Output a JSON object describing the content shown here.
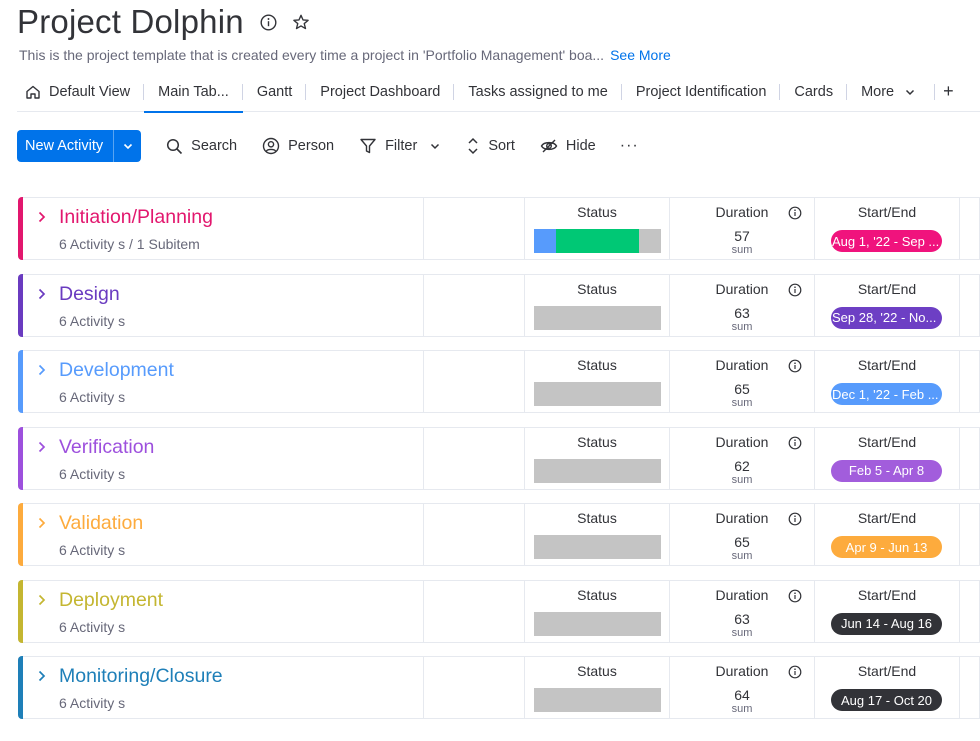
{
  "header": {
    "title": "Project Dolphin",
    "description": "This is the project template that is created every time a project in 'Portfolio Management' boa...",
    "see_more": "See More"
  },
  "tabs": [
    {
      "label": "Default View",
      "icon": "home-icon"
    },
    {
      "label": "Main Tab...",
      "active": true
    },
    {
      "label": "Gantt"
    },
    {
      "label": "Project Dashboard"
    },
    {
      "label": "Tasks assigned to me"
    },
    {
      "label": "Project Identification"
    },
    {
      "label": "Cards"
    },
    {
      "label": "More"
    }
  ],
  "tab_add": "+",
  "toolbar": {
    "new_label": "New Activity",
    "search": "Search",
    "person": "Person",
    "filter": "Filter",
    "sort": "Sort",
    "hide": "Hide",
    "more": "···"
  },
  "columns": {
    "status": "Status",
    "duration": "Duration",
    "start_end": "Start/End",
    "sum": "sum"
  },
  "colors": {
    "accent": "#0073ea",
    "status_gray": "#c4c4c4",
    "status_green": "#00c875",
    "status_blue": "#579bfc"
  },
  "groups": [
    {
      "name": "Initiation/Planning",
      "count": "6 Activity s / 1 Subitem",
      "color": "#e2176e",
      "duration": "57",
      "dates": "Aug 1, '22 - Sep ...",
      "pill_color": "#f0137d",
      "status": [
        {
          "color": "#579bfc",
          "share": 0.17
        },
        {
          "color": "#00c875",
          "share": 0.66
        }
      ]
    },
    {
      "name": "Design",
      "count": "6 Activity s",
      "color": "#6a3bc0",
      "duration": "63",
      "dates": "Sep 28, '22 - No...",
      "pill_color": "#6d3fc4",
      "status": []
    },
    {
      "name": "Development",
      "count": "6 Activity s",
      "color": "#579bfc",
      "duration": "65",
      "dates": "Dec 1, '22 - Feb ...",
      "pill_color": "#579bfc",
      "status": []
    },
    {
      "name": "Verification",
      "count": "6 Activity s",
      "color": "#9d50dd",
      "duration": "62",
      "dates": "Feb 5 - Apr 8",
      "pill_color": "#a25ddc",
      "status": []
    },
    {
      "name": "Validation",
      "count": "6 Activity s",
      "color": "#fdab3d",
      "duration": "65",
      "dates": "Apr 9 - Jun 13",
      "pill_color": "#fdab3d",
      "status": []
    },
    {
      "name": "Deployment",
      "count": "6 Activity s",
      "color": "#c4b631",
      "duration": "63",
      "dates": "Jun 14 - Aug 16",
      "pill_color": "#323338",
      "status": []
    },
    {
      "name": "Monitoring/Closure",
      "count": "6 Activity s",
      "color": "#1e7fb8",
      "duration": "64",
      "dates": "Aug 17 - Oct 20",
      "pill_color": "#323338",
      "status": []
    }
  ]
}
